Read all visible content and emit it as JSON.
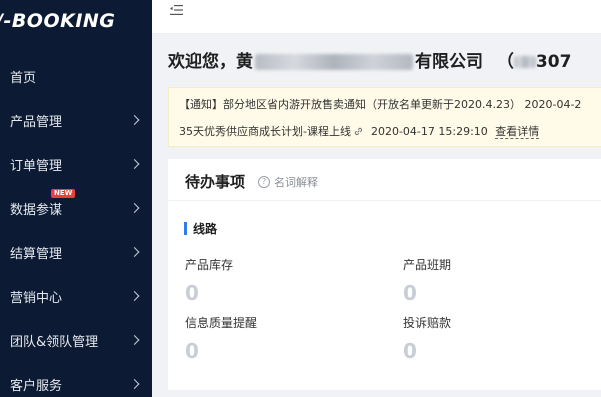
{
  "sidebar": {
    "logo": "/-BOOKING",
    "items": [
      {
        "label": "首页",
        "has_chevron": false
      },
      {
        "label": "产品管理",
        "has_chevron": true
      },
      {
        "label": "订单管理",
        "has_chevron": true
      },
      {
        "label": "数据参谋",
        "has_chevron": true,
        "badge": "NEW"
      },
      {
        "label": "结算管理",
        "has_chevron": true
      },
      {
        "label": "营销中心",
        "has_chevron": true
      },
      {
        "label": "团队&领队管理",
        "has_chevron": true
      },
      {
        "label": "客户服务",
        "has_chevron": true
      }
    ]
  },
  "topbar": {
    "fold_icon": "menu-fold-icon"
  },
  "welcome": {
    "prefix": "欢迎您，黄",
    "company_suffix": "有限公司",
    "tail": "（",
    "account_suffix": "307"
  },
  "notice": {
    "line1": "【通知】部分地区省内游开放售卖通知（开放名单更新于2020.4.23）  2020-04-2",
    "line2_text": "35天优秀供应商成长计划-课程上线",
    "line2_time": "2020-04-17 15:29:10",
    "line2_link": "查看详情"
  },
  "todo": {
    "title": "待办事项",
    "help_label": "名词解释",
    "section": "线路",
    "stats": [
      {
        "label": "产品库存",
        "value": "0"
      },
      {
        "label": "产品班期",
        "value": "0"
      },
      {
        "label": "信息质量提醒",
        "value": "0"
      },
      {
        "label": "投诉赔款",
        "value": "0"
      }
    ]
  },
  "colors": {
    "sidebar_bg": "#0c1b33",
    "accent_blue": "#2f7bf0",
    "notice_bg": "#fffbe8",
    "badge_red": "#e8413c",
    "zero_value": "#c9ced6"
  }
}
